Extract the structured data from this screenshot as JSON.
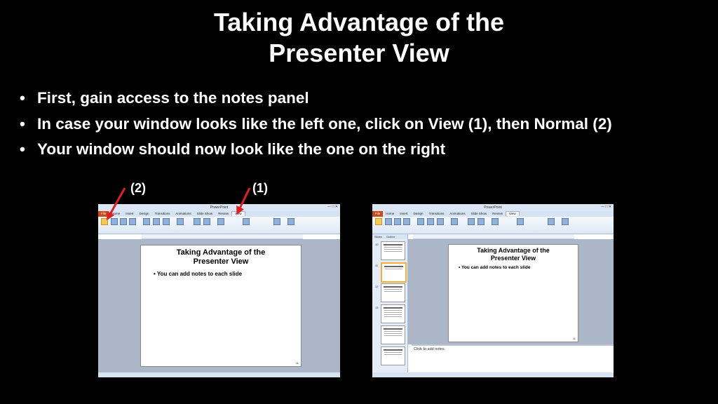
{
  "slide": {
    "title_line1": "Taking Advantage of the",
    "title_line2": "Presenter View",
    "bullets": [
      "First, gain access to the notes panel",
      "In case your window looks like the left one, click on View (1), then Normal (2)",
      "Your window should now look like the one on the right"
    ],
    "callouts": {
      "normal": "(2)",
      "view": "(1)"
    },
    "accent_color": "#e02020"
  },
  "left_shot": {
    "tabs": [
      "File",
      "Home",
      "Insert",
      "Design",
      "Transitions",
      "Animations",
      "Slide Show",
      "Review",
      "View"
    ],
    "active_tab": "View",
    "slide_title_line1": "Taking Advantage of the",
    "slide_title_line2": "Presenter View",
    "slide_bullet": "You can add notes to each slide",
    "slide_number": "11"
  },
  "right_shot": {
    "tabs": [
      "File",
      "Home",
      "Insert",
      "Design",
      "Transitions",
      "Animations",
      "Slide Show",
      "Review",
      "View"
    ],
    "active_tab": "View",
    "panel_tabs": [
      "Slides",
      "Outline"
    ],
    "thumb_numbers": [
      "10",
      "11",
      "12",
      "13"
    ],
    "slide_title_line1": "Taking Advantage of the",
    "slide_title_line2": "Presenter View",
    "slide_bullet": "You can add notes to each slide",
    "slide_number": "11",
    "notes_placeholder": "Click to add notes"
  }
}
